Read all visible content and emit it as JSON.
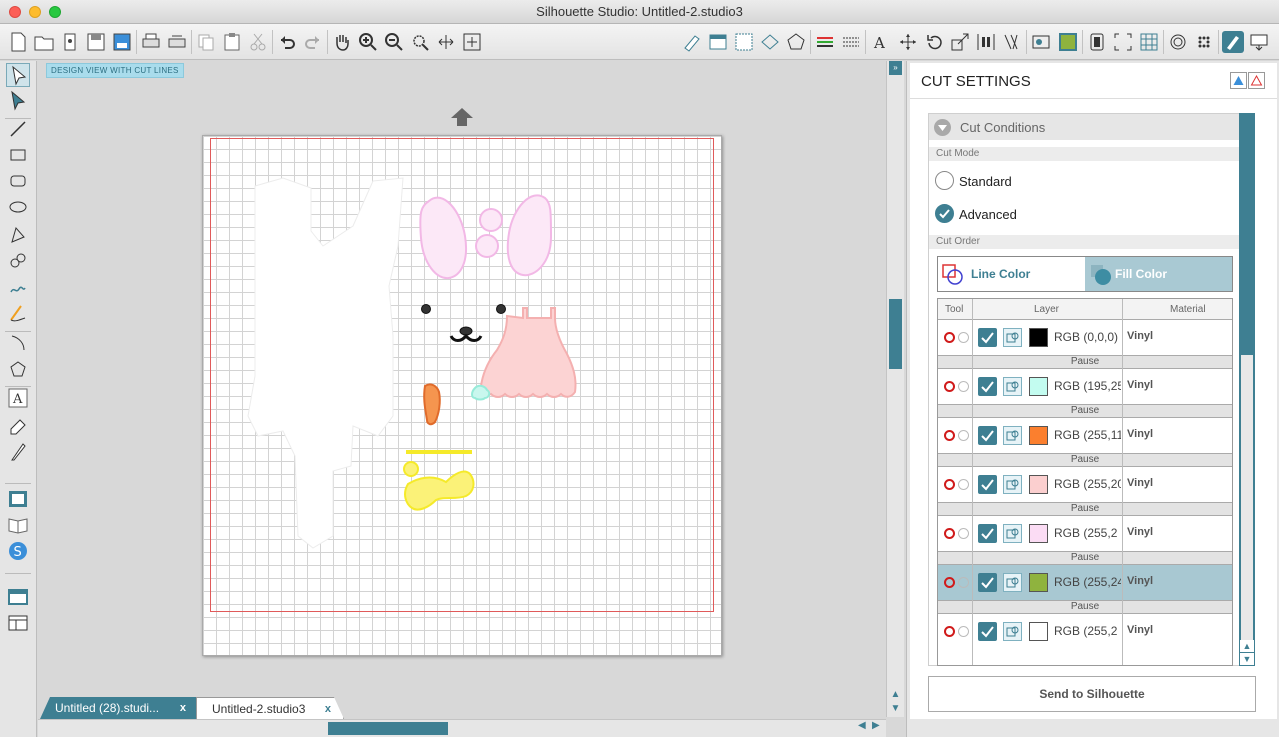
{
  "window": {
    "title": "Silhouette Studio: Untitled-2.studio3"
  },
  "canvas": {
    "view_label": "DESIGN VIEW WITH CUT LINES"
  },
  "tabs": [
    {
      "label": "Untitled (28).studi...",
      "close": "x"
    },
    {
      "label": "Untitled-2.studio3",
      "close": "x"
    }
  ],
  "cut_settings": {
    "title": "CUT SETTINGS",
    "section": "Cut Conditions",
    "cut_mode_label": "Cut Mode",
    "modes": [
      {
        "label": "Standard",
        "selected": false
      },
      {
        "label": "Advanced",
        "selected": true
      }
    ],
    "cut_order_label": "Cut Order",
    "order_buttons": {
      "line": "Line Color",
      "fill": "Fill Color"
    },
    "table_headers": {
      "tool": "Tool",
      "layer": "Layer",
      "material": "Material"
    },
    "pause_label": "Pause",
    "layers": [
      {
        "rgb": "RGB (0,0,0)",
        "color": "#000000",
        "material": "Vinyl",
        "highlight": false
      },
      {
        "rgb": "RGB (195,25",
        "color": "#c3fcf0",
        "material": "Vinyl",
        "highlight": false
      },
      {
        "rgb": "RGB (255,11",
        "color": "#fb7f2e",
        "material": "Vinyl",
        "highlight": false
      },
      {
        "rgb": "RGB (255,20",
        "color": "#fbcfcf",
        "material": "Vinyl",
        "highlight": false
      },
      {
        "rgb": "RGB (255,2",
        "color": "#fbdcf4",
        "material": "Vinyl",
        "highlight": false
      },
      {
        "rgb": "RGB (255,24",
        "color": "#8fb33e",
        "material": "Vinyl",
        "highlight": true
      },
      {
        "rgb": "RGB (255,2",
        "color": "#ffffff",
        "material": "Vinyl",
        "highlight": false
      }
    ],
    "send_button": "Send to Silhouette"
  },
  "colors": {
    "accent": "#3e7f92",
    "cut_line": "#e05a5a"
  }
}
